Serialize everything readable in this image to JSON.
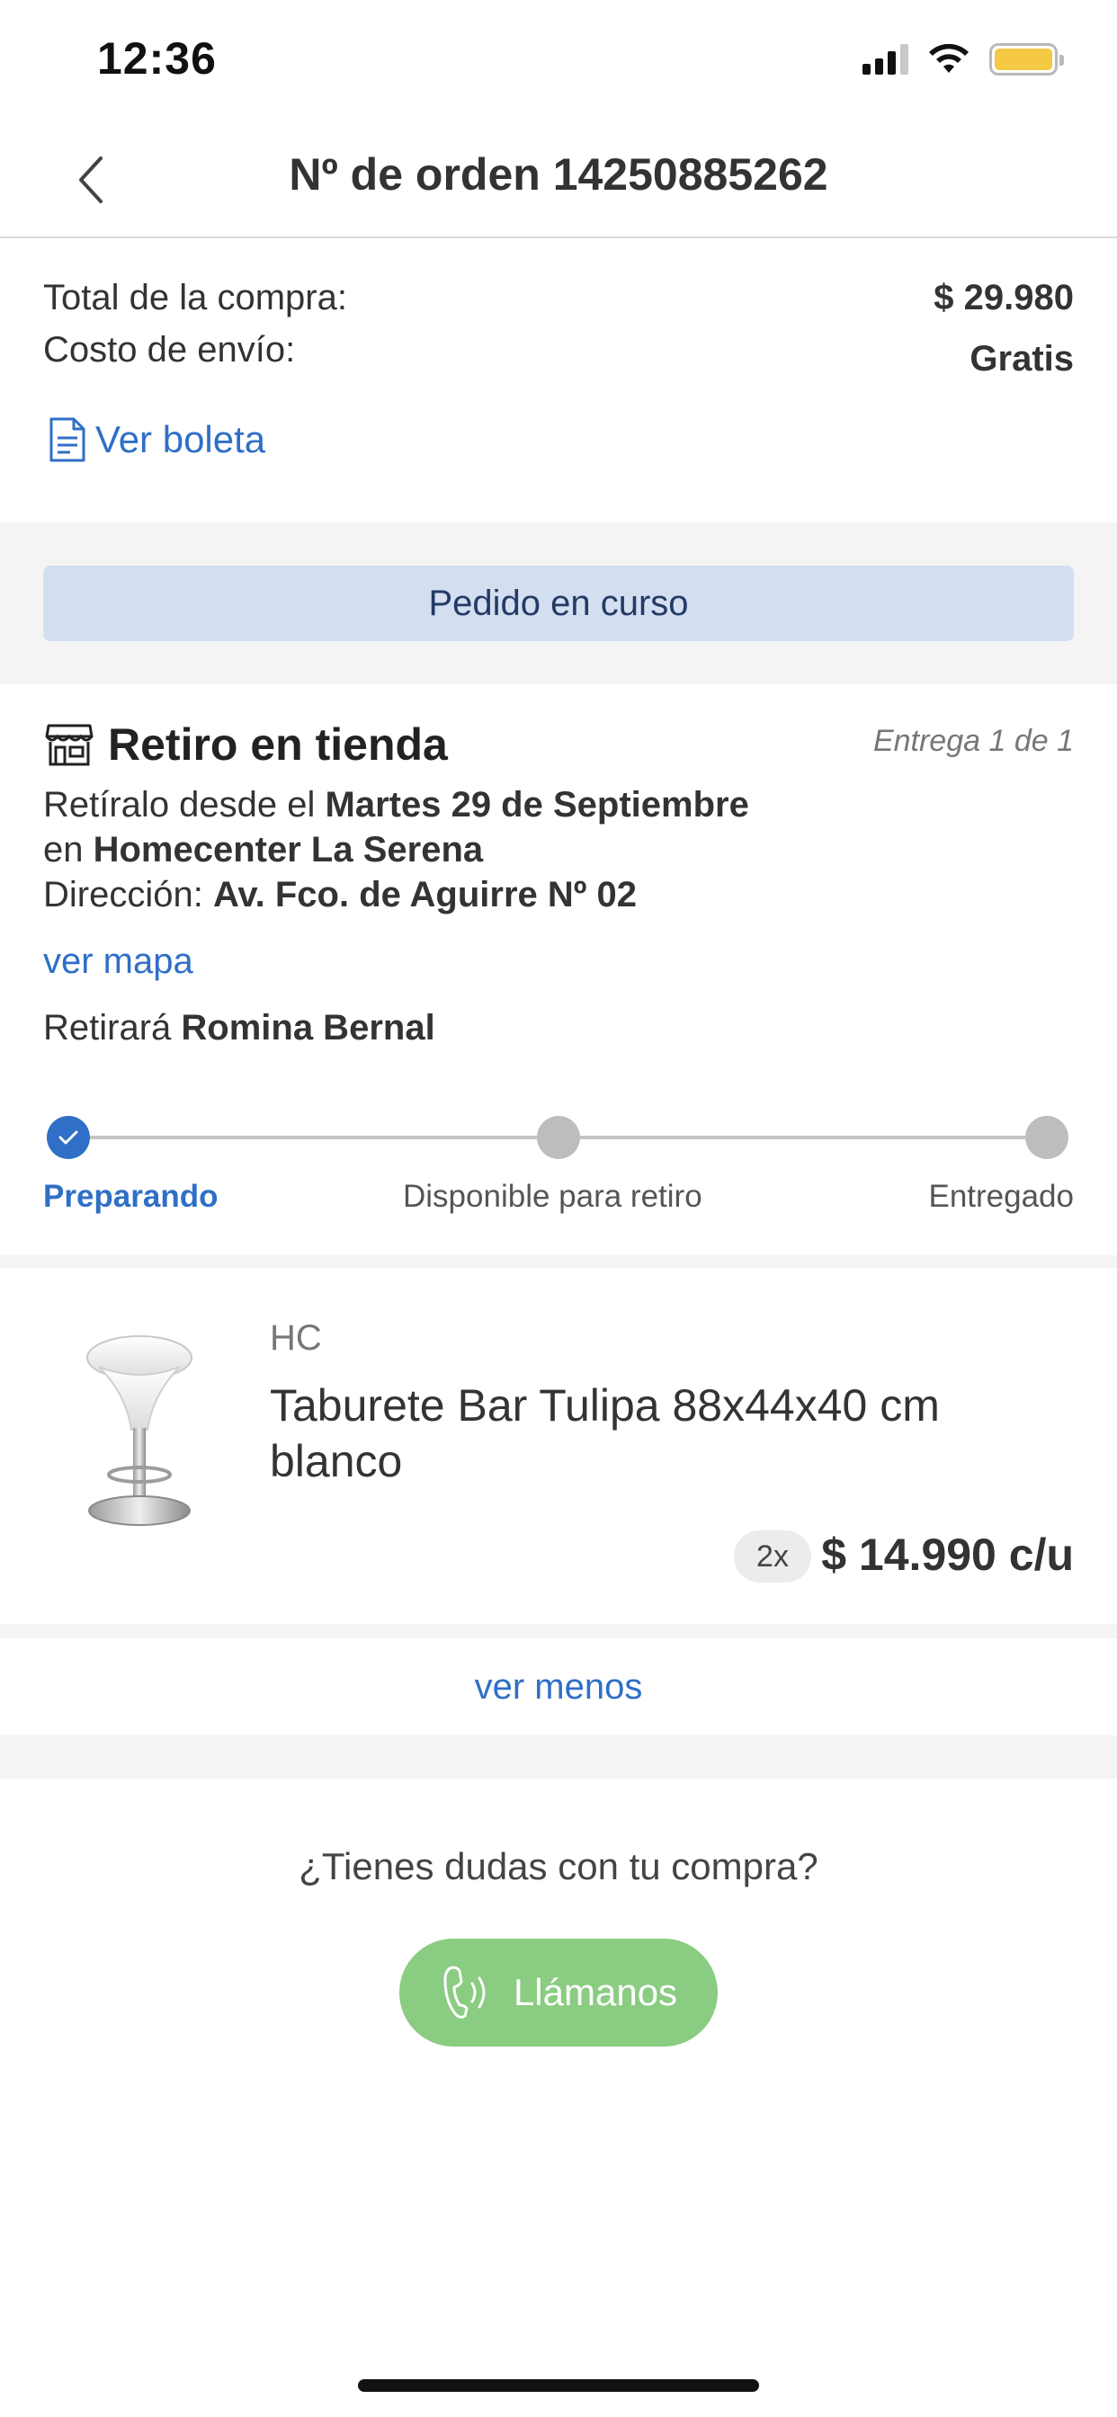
{
  "status_bar": {
    "time": "12:36"
  },
  "nav": {
    "title": "Nº de orden 14250885262"
  },
  "summary": {
    "total_label": "Total de la compra:",
    "total_value": "$ 29.980",
    "shipping_label": "Costo de envío:",
    "shipping_value": "Gratis",
    "receipt_link": "Ver boleta"
  },
  "order_status": {
    "label": "Pedido en curso"
  },
  "pickup": {
    "title": "Retiro en tienda",
    "delivery_count": "Entrega  1 de 1",
    "line1_prefix": "Retíralo desde el ",
    "date": "Martes 29 de Septiembre",
    "line2_prefix": "en ",
    "store": "Homecenter La Serena",
    "line3_prefix": "Dirección: ",
    "address": "Av. Fco. de Aguirre Nº 02",
    "map_link": "ver mapa",
    "picker_prefix": "Retirará ",
    "picker_name": "Romina Bernal"
  },
  "progress": {
    "steps": [
      {
        "label": "Preparando",
        "state": "done"
      },
      {
        "label": "Disponible para retiro",
        "state": "pending"
      },
      {
        "label": "Entregado",
        "state": "pending"
      }
    ]
  },
  "product": {
    "brand": "HC",
    "name": "Taburete Bar Tulipa 88x44x40 cm blanco",
    "quantity": "2x",
    "unit_price": "$ 14.990 c/u"
  },
  "toggle_link": "ver menos",
  "help": {
    "question": "¿Tienes dudas con tu compra?",
    "call_button": "Llámanos"
  },
  "colors": {
    "accent": "#2f6fc7",
    "status_pill": "#d3dff1",
    "call_button": "#8acc81",
    "battery": "#f6c944"
  }
}
